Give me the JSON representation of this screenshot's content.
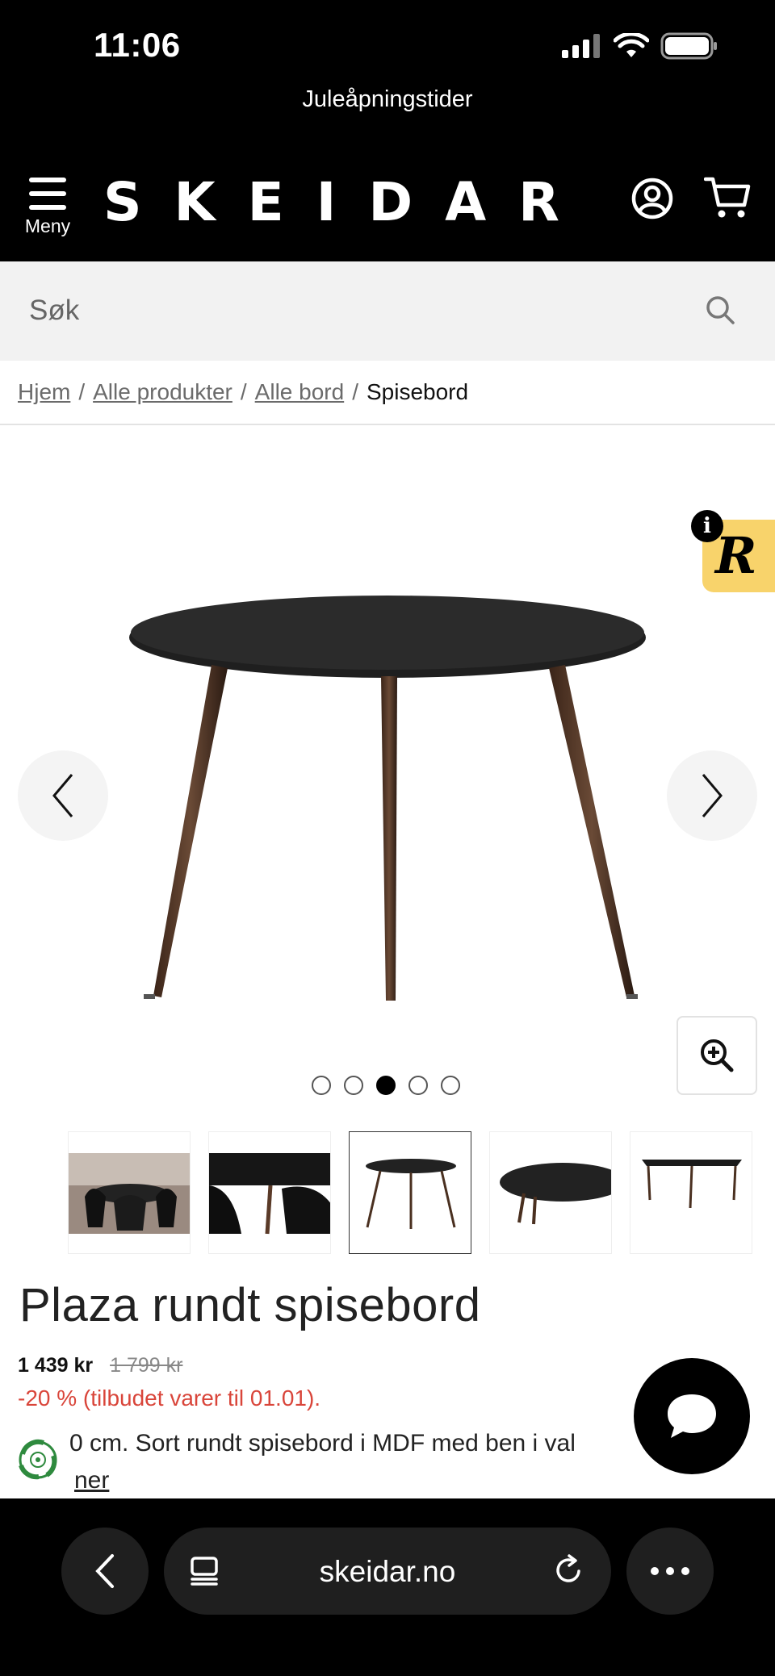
{
  "status_bar": {
    "time": "11:06"
  },
  "promo": {
    "text": "Juleåpningstider"
  },
  "header": {
    "logo": "SKEIDAR",
    "menu_label": "Meny"
  },
  "search": {
    "placeholder": "Søk",
    "value": ""
  },
  "breadcrumb": {
    "items": [
      "Hjem",
      "Alle produkter",
      "Alle bord"
    ],
    "current": "Spisebord",
    "separator": "/"
  },
  "gallery": {
    "image_count": 5,
    "active_index": 3,
    "badge_letter": "R",
    "info_letter": "i"
  },
  "product": {
    "title": "Plaza rundt spisebord",
    "price": "1 439 kr",
    "old_price": "1 799 kr",
    "discount": "-20 % (tilbudet varer til 01.01).",
    "description": "0 cm. Sort rundt spisebord i MDF med ben i val",
    "read_more": "ner"
  },
  "browser": {
    "url": "skeidar.no"
  },
  "colors": {
    "header_bg": "#000000",
    "discount_red": "#d9453a",
    "badge_yellow": "#f8d36b"
  }
}
